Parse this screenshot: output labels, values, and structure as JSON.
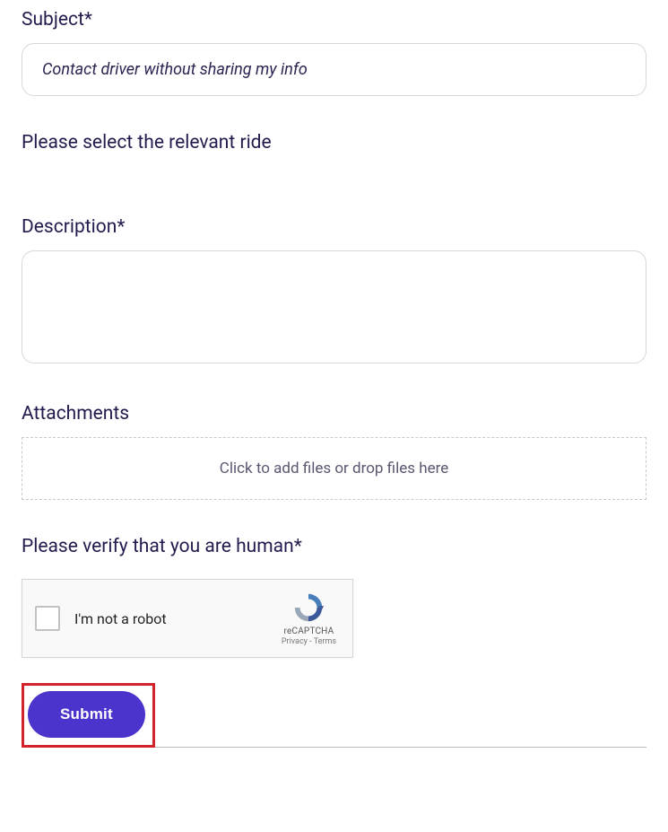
{
  "subject": {
    "label": "Subject*",
    "value": "Contact driver without sharing my info"
  },
  "ride": {
    "label": "Please select the relevant ride"
  },
  "description": {
    "label": "Description*",
    "value": ""
  },
  "attachments": {
    "label": "Attachments",
    "dropzone_text": "Click to add files or drop files here"
  },
  "captcha": {
    "label": "Please verify that you are human*",
    "checkbox_label": "I'm not a robot",
    "brand": "reCAPTCHA",
    "privacy": "Privacy",
    "terms": "Terms",
    "separator": " - "
  },
  "submit": {
    "label": "Submit"
  }
}
